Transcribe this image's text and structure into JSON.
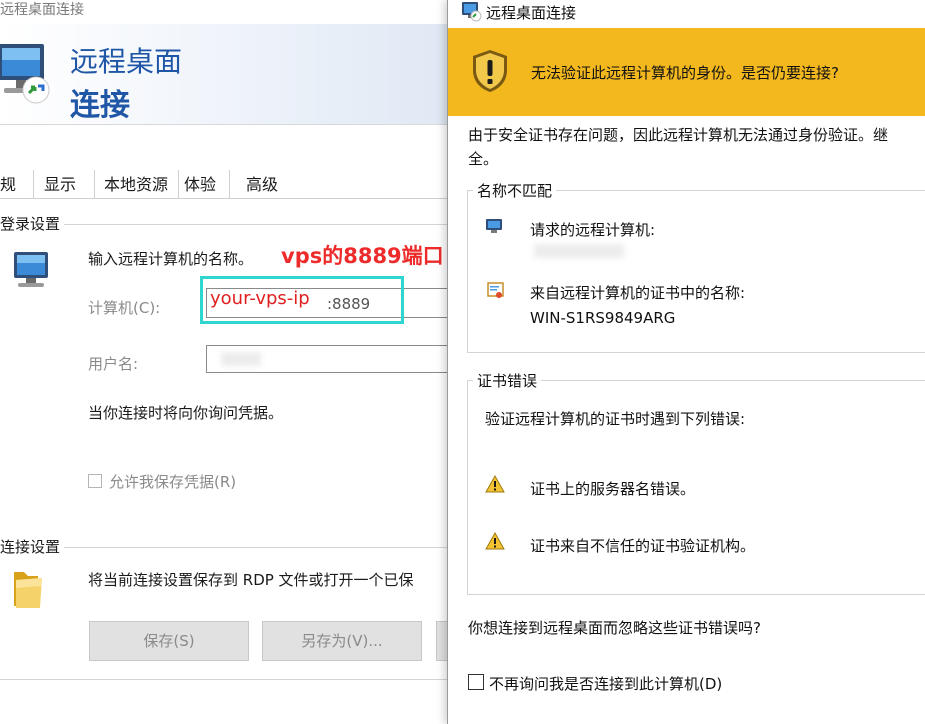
{
  "left_window": {
    "title": "远程桌面连接",
    "banner_line1": "远程桌面",
    "banner_line2": "连接",
    "tabs": [
      {
        "label": "规"
      },
      {
        "label": "显示"
      },
      {
        "label": "本地资源"
      },
      {
        "label": "体验"
      },
      {
        "label": "高级"
      }
    ],
    "logon_group": {
      "title": "登录设置",
      "prompt": "输入远程计算机的名称。",
      "computer_label": "计算机(C):",
      "computer_value": ":8889",
      "username_label": "用户名:",
      "credential_note": "当你连接时将向你询问凭据。",
      "save_credentials_label": "允许我保存凭据(R)"
    },
    "connection_group": {
      "title": "连接设置",
      "description": "将当前连接设置保存到 RDP 文件或打开一个已保",
      "save_button": "保存(S)",
      "save_as_button": "另存为(V)..."
    }
  },
  "annotations": {
    "host_placeholder": "your-vps-ip",
    "port_note": "vps的8889端口",
    "box_color": "#2fd6d0",
    "text_color": "#e02020"
  },
  "dialog": {
    "title": "远程桌面连接",
    "warning_banner": "无法验证此远程计算机的身份。是否仍要连接?",
    "body_text": "由于安全证书存在问题，因此远程计算机无法通过身份验证。继续连接可能不安全。",
    "body_line1": "由于安全证书存在问题，因此远程计算机无法通过身份验证。继",
    "body_line2": "全。",
    "name_mismatch": {
      "title": "名称不匹配",
      "requested_label": "请求的远程计算机:",
      "cert_name_label": "来自远程计算机的证书中的名称:",
      "cert_name_value": "WIN-S1RS9849ARG"
    },
    "cert_errors": {
      "title": "证书错误",
      "intro": "验证远程计算机的证书时遇到下列错误:",
      "errors": [
        "证书上的服务器名错误。",
        "证书来自不信任的证书验证机构。"
      ]
    },
    "question": "你想连接到远程桌面而忽略这些证书错误吗?",
    "dont_ask_label": "不再询问我是否连接到此计算机(D)",
    "colors": {
      "banner": "#f3b81e"
    }
  }
}
